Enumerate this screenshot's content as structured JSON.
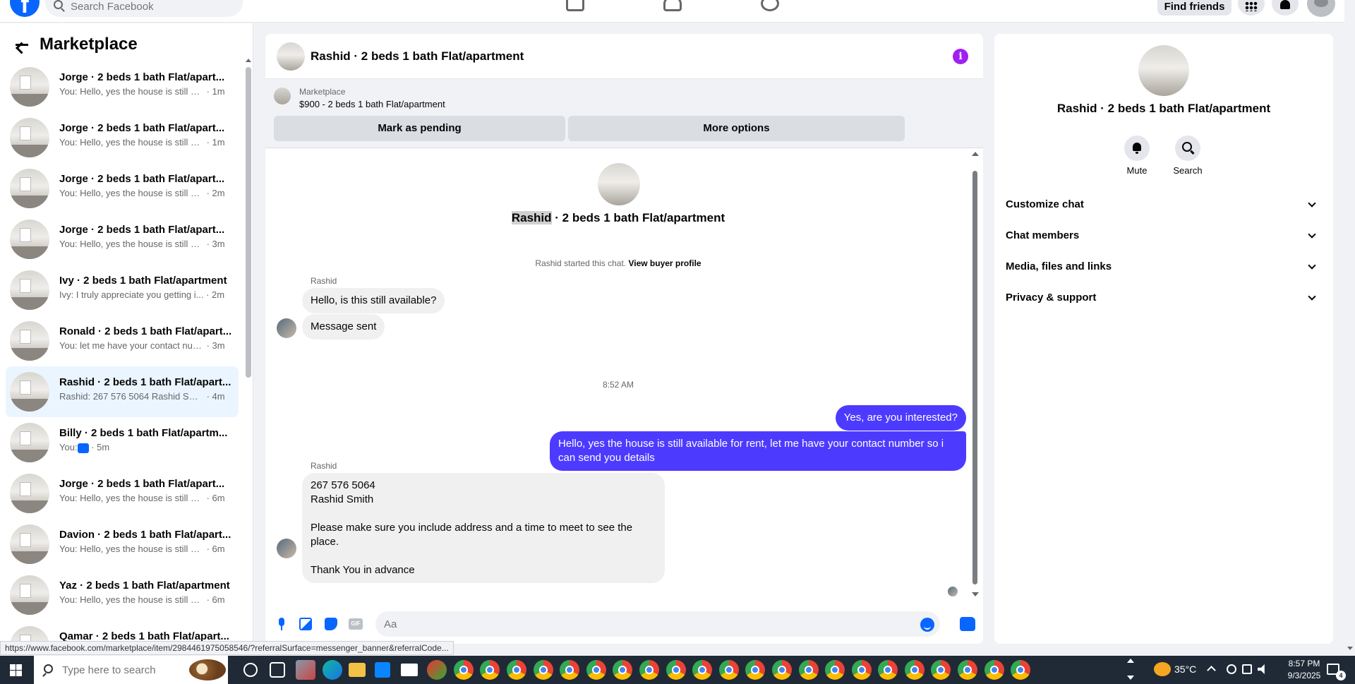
{
  "topbar": {
    "search_placeholder": "Search Facebook",
    "find_friends": "Find friends"
  },
  "sidebar": {
    "title": "Marketplace",
    "conversations": [
      {
        "title": "Jorge · 2 beds 1 bath Flat/apart...",
        "preview": "You: Hello, yes the house is still av...",
        "time": " · 1m",
        "active": false
      },
      {
        "title": "Jorge · 2 beds 1 bath Flat/apart...",
        "preview": "You: Hello, yes the house is still av...",
        "time": " · 1m",
        "active": false
      },
      {
        "title": "Jorge · 2 beds 1 bath Flat/apart...",
        "preview": "You: Hello, yes the house is still av...",
        "time": " · 2m",
        "active": false
      },
      {
        "title": "Jorge · 2 beds 1 bath Flat/apart...",
        "preview": "You: Hello, yes the house is still av...",
        "time": " · 3m",
        "active": false
      },
      {
        "title": "Ivy · 2 beds 1 bath Flat/apartment",
        "preview": "Ivy: I truly appreciate you getting i...",
        "time": " · 2m",
        "active": false
      },
      {
        "title": "Ronald · 2 beds 1 bath Flat/apart...",
        "preview": "You: let me have your contact num...",
        "time": " · 3m",
        "active": false
      },
      {
        "title": "Rashid · 2 beds 1 bath Flat/apart...",
        "preview": "Rashid: 267 576 5064 Rashid Smith...",
        "time": " · 4m",
        "active": true
      },
      {
        "title": "Billy · 2 beds 1 bath Flat/apartm...",
        "preview": "You: ",
        "time": " · 5m",
        "active": false,
        "like": true
      },
      {
        "title": "Jorge · 2 beds 1 bath Flat/apart...",
        "preview": "You: Hello, yes the house is still av...",
        "time": " · 6m",
        "active": false
      },
      {
        "title": "Davion · 2 beds 1 bath Flat/apart...",
        "preview": "You: Hello, yes the house is still av...",
        "time": " · 6m",
        "active": false
      },
      {
        "title": "Yaz · 2 beds 1 bath Flat/apartment",
        "preview": "You: Hello, yes the house is still av...",
        "time": " · 6m",
        "active": false
      },
      {
        "title": "Qamar · 2 beds 1 bath Flat/apart...",
        "preview": "",
        "time": "",
        "active": false
      }
    ]
  },
  "chat": {
    "title": "Rashid · 2 beds 1 bath Flat/apartment",
    "info_icon": "i",
    "banner": {
      "label": "Marketplace",
      "item": "$900 - 2 beds 1 bath Flat/apartment",
      "mark_pending": "Mark as pending",
      "more_options": "More options"
    },
    "intro": {
      "name": "Rashid",
      "rest": " · 2 beds 1 bath Flat/apartment",
      "started_text": "Rashid started this chat.",
      "view_profile": "View buyer profile"
    },
    "sender1": "Rashid",
    "msg1": "Hello, is this still available?",
    "msg2": "Message sent",
    "timestamp": "8:52 AM",
    "out1": "Yes, are you interested?",
    "out2_line1": "Hello, yes the house is still available for rent, let me have your contact number so i",
    "out2_line2": "can send you details",
    "sender2": "Rashid",
    "msg3": "267 576 5064\nRashid Smith\n\nPlease make sure you include address and a time to meet to see the place.\n\nThank You in advance",
    "input_placeholder": "Aa",
    "gif_label": "GIF"
  },
  "right_panel": {
    "title": "Rashid · 2 beds 1 bath Flat/apartment",
    "mute": "Mute",
    "search": "Search",
    "sections": [
      "Customize chat",
      "Chat members",
      "Media, files and links",
      "Privacy & support"
    ]
  },
  "status_url": "https://www.facebook.com/marketplace/item/2984461975058546/?referralSurface=messenger_banner&referralCode...",
  "taskbar": {
    "search_placeholder": "Type here to search",
    "temperature": "35°C",
    "time": "8:57 PM",
    "date": "9/3/2025",
    "notification_count": "4"
  },
  "colors": {
    "accent": "#0866ff",
    "outgoing_bubble": "#4c3bff",
    "info_icon": "#a020f0",
    "active_conversation": "#ebf5ff"
  }
}
